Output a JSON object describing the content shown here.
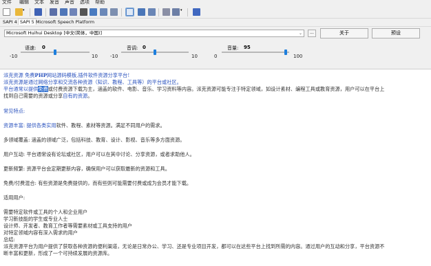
{
  "menu": [
    "文件",
    "编辑",
    "文本",
    "发音",
    "声音",
    "选项",
    "帮助"
  ],
  "tabs": [
    "SAPI 4",
    "SAPI 5",
    "Microsoft Speech Platform"
  ],
  "voice": {
    "selected": "Microsoft Huihui Desktop [中文(简体，中国)]"
  },
  "buttons": {
    "more": "...",
    "about": "关于",
    "preview": "预设"
  },
  "sliders": [
    {
      "label": "语速:",
      "value": "0",
      "min": "-10",
      "max": "10",
      "level": 0.5
    },
    {
      "label": "音调:",
      "value": "0",
      "min": "-10",
      "max": "10",
      "level": 0.5
    },
    {
      "label": "音量:",
      "value": "95",
      "min": "0",
      "max": "100",
      "level": 0.95
    }
  ],
  "text": {
    "l1a": "派克资源 免费",
    "l1b": "PHP",
    "l1c": "网站源码模板,插件软件资源分享平台!",
    "l2": "派克资源是通过网络分享和交流各种资源（知识、教程、工具等）的平台或社区。",
    "l3a": "平台通常以提供",
    "l3hl": "免费",
    "l3b": "或付费资源下载为主，涵盖的软件、电影、音乐、学习资料等内容。派克资源可能专注于特定领域，如设计素材、编程工具或教育资源，用户可以在平台上",
    "l4a": "找到自己需要的资源或分享",
    "l4b": "自有的资源",
    "l4c": "。",
    "h1": "常见特点:",
    "p1a": "资源丰富: 提供",
    "p1b": "各类实用",
    "p1c": "软件、教程、素材等资源。满足不同用户的需求。",
    "p2": "多领域覆盖: 涵盖的领域广泛，包括科技、教育、设计、影视、音乐等多方面资源。",
    "p3": "用户互动: 平台通常设有论坛或社区，用户可以在其中讨论、分享资源，或者求助他人。",
    "p4": "更新频繁: 资源平台会定期更新内容，确保用户可以获取最新的资源和工具。",
    "p5": "免费/付费混合: 有些资源是免费提供的，而有些则可能需要付费或成为会员才能下载。",
    "h2": "适用用户:",
    "u1": "需要特定软件或工具的个人和企业用户",
    "u2": "学习新技能的学生或专业人士",
    "u3": "设计师、开发者、教育工作者等需要素材或工具支持的用户",
    "u4": "对特定领域内容有深入需求的用户",
    "sum": "总结:",
    "s1": "派克资源平台为用户提供了获取各种资源的便利渠道，无论是日常办公、学习、还是专业项目开发，都可以在这些平台上找到所需的内容。通过用户的互动和分享，平台资源不",
    "s2": "断丰富和更新，形成了一个可持续发展的资源库。"
  }
}
